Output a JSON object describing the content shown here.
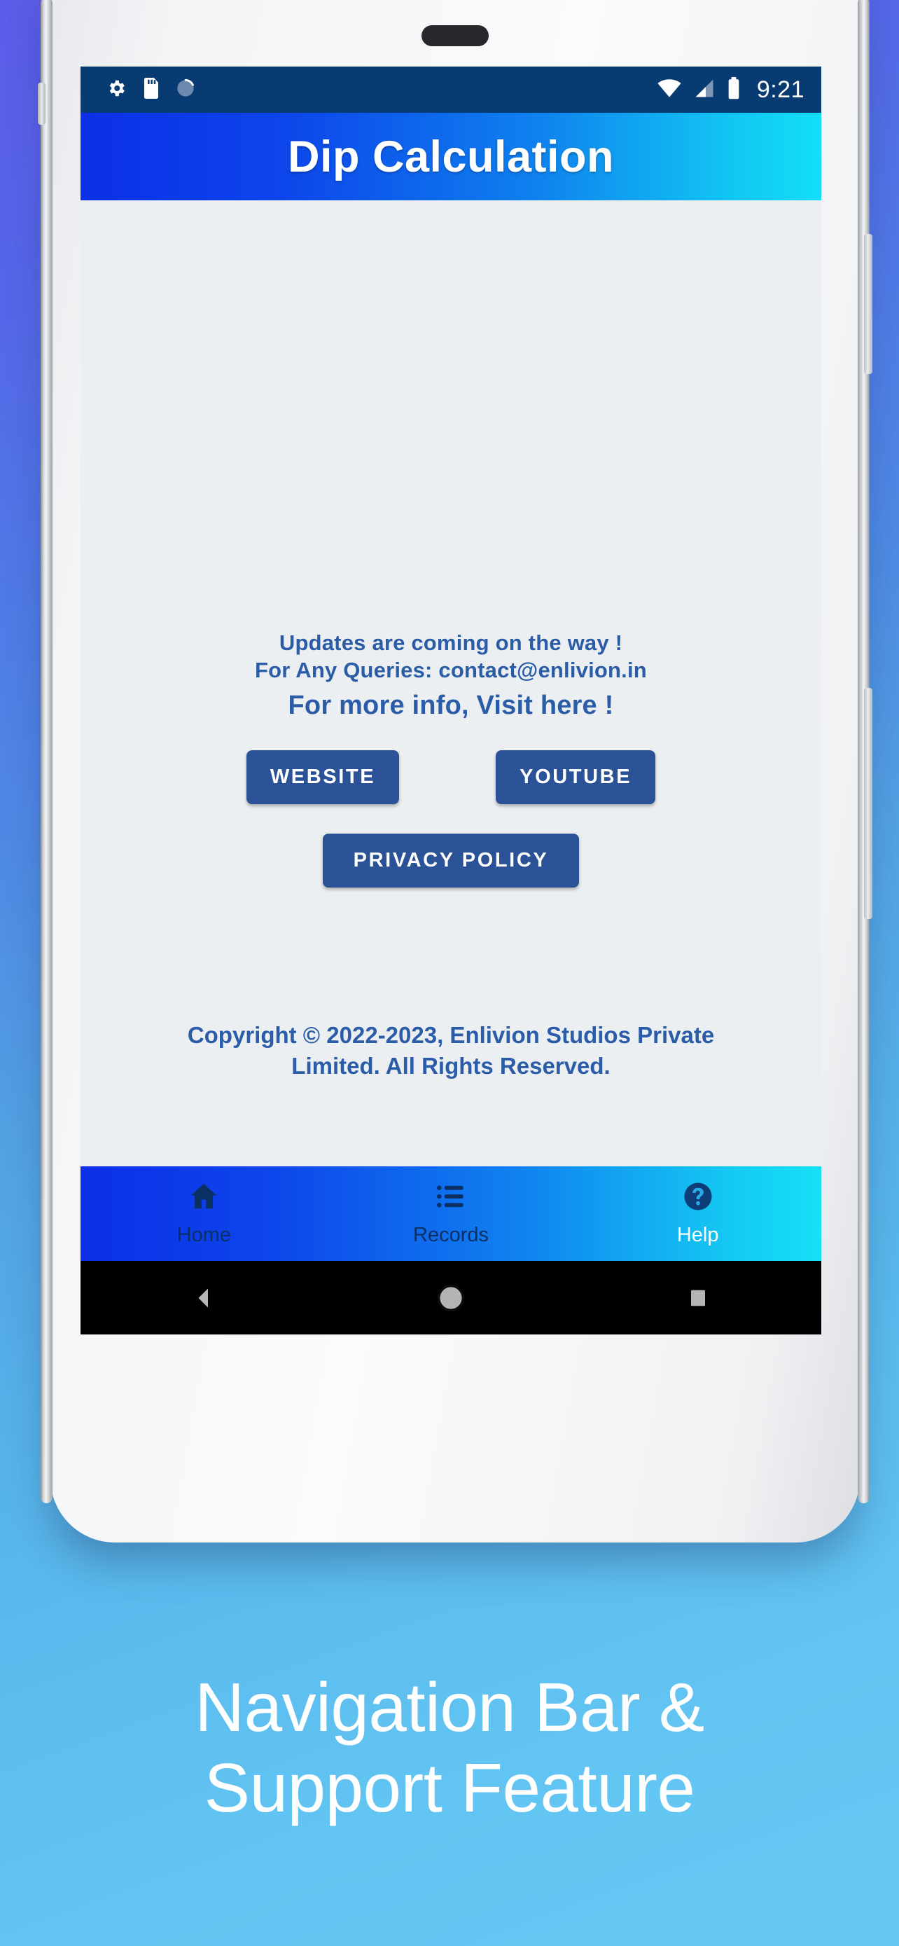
{
  "theme": {
    "page_bg_top": "#5c5ce8",
    "page_bg_bottom": "#66c9f5",
    "appbar_gradient_start": "#0c2fe8",
    "appbar_gradient_end": "#12dff5",
    "statusbar_bg": "#083b71",
    "screen_bg": "#eceff1",
    "brand_text": "#2a5ca8",
    "button_bg": "#2b5296",
    "nav_label_dark": "#0a2f63",
    "nav_label_light": "#ffffff"
  },
  "statusbar": {
    "left_icons": [
      "gear-icon",
      "sd-card-icon",
      "sync-circle-icon"
    ],
    "right_icons": [
      "wifi-icon",
      "cell-signal-icon",
      "battery-icon"
    ],
    "clock": "9:21"
  },
  "appbar": {
    "title": "Dip Calculation"
  },
  "main": {
    "line1": "Updates are coming on the way !",
    "line2": "For Any Queries: contact@enlivion.in",
    "line3": "For more info, Visit here  !",
    "buttons": [
      {
        "label": "WEBSITE",
        "name": "website-button"
      },
      {
        "label": "YOUTUBE",
        "name": "youtube-button"
      },
      {
        "label": "PRIVACY POLICY",
        "name": "privacy-policy-button"
      }
    ],
    "copyright_line1": "Copyright © 2022-2023, Enlivion Studios Private",
    "copyright_line2": "Limited. All Rights Reserved."
  },
  "bottom_nav": {
    "items": [
      {
        "label": "Home",
        "icon": "home-icon",
        "active": true
      },
      {
        "label": "Records",
        "icon": "list-icon",
        "active": false
      },
      {
        "label": "Help",
        "icon": "help-circle-icon",
        "active": false
      }
    ]
  },
  "system_nav": {
    "back": "back-triangle-icon",
    "home": "home-circle-icon",
    "recents": "recents-square-icon"
  },
  "caption": {
    "line1": "Navigation Bar &",
    "line2": "Support Feature"
  }
}
